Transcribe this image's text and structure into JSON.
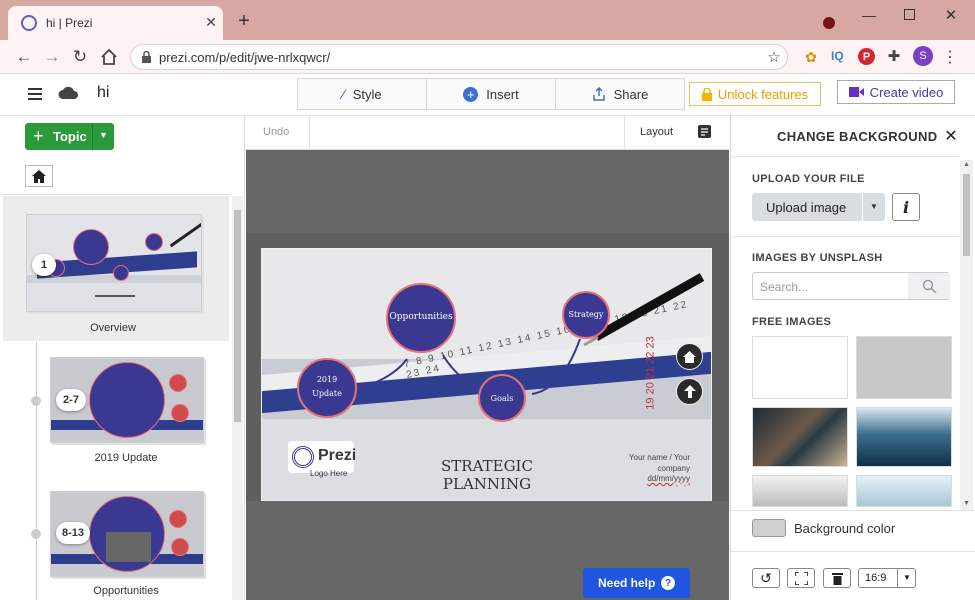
{
  "browser": {
    "tab_title": "hi | Prezi",
    "url": "prezi.com/p/edit/jwe-nrlxqwcr/",
    "profile_initial": "S",
    "ext_iq": "IQ"
  },
  "header": {
    "doc_title": "hi",
    "style_label": "Style",
    "insert_label": "Insert",
    "share_label": "Share",
    "unlock_label": "Unlock features",
    "video_label": "Create video"
  },
  "left": {
    "topic_label": "Topic",
    "thumbs": [
      {
        "badge": "1",
        "label": "Overview"
      },
      {
        "badge": "2-7",
        "label": "2019 Update"
      },
      {
        "badge": "8-13",
        "label": "Opportunities"
      }
    ]
  },
  "toolbar": {
    "undo_label": "Undo",
    "layout_label": "Layout"
  },
  "slide": {
    "opportunities": "Opportunities",
    "strategy": "Strategy",
    "update": "2019 Update",
    "goals": "Goals",
    "title": "STRATEGIC PLANNING",
    "logo_text": "Prezi",
    "logo_sub": "Logo Here",
    "name_line1": "Your name / Your",
    "name_line2": "company",
    "date": "dd/mm/yyyy",
    "calendar_days": "7  8  9  10  11  12  13  14  15  16  17  18  19  20  21  22  23  24",
    "calendar_days2": "19 20 21 22 23"
  },
  "help": {
    "label": "Need help"
  },
  "panel": {
    "title": "CHANGE BACKGROUND",
    "upload_heading": "UPLOAD YOUR FILE",
    "upload_button": "Upload image",
    "unsplash_heading": "IMAGES BY UNSPLASH",
    "search_placeholder": "Search...",
    "free_heading": "FREE IMAGES",
    "bg_color_label": "Background color",
    "ratio": "16:9"
  },
  "colors": {
    "accent": "#3b3892",
    "green": "#2a9a3a",
    "help_blue": "#1f55e0",
    "unlock_yellow": "#f5b400"
  }
}
